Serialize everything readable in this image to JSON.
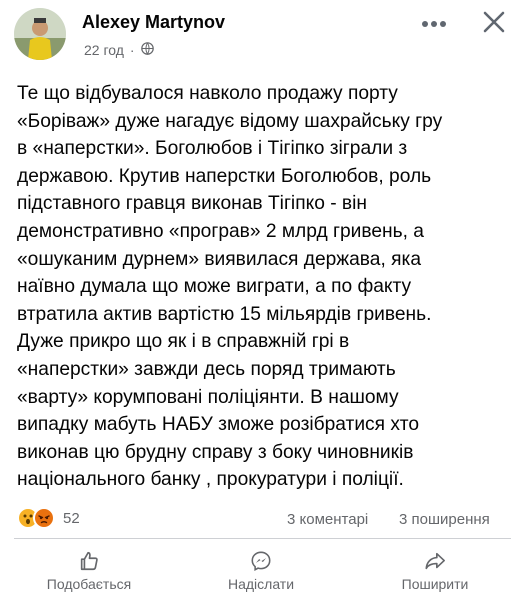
{
  "post": {
    "author": "Alexey Martynov",
    "time": "22 год",
    "text_lines": [
      "Те що відбувалося навколо продажу порту",
      "«Боріваж» дуже нагадує відому шахрайську гру",
      "в «наперстки». Боголюбов і Тігіпко зіграли з",
      "державою. Крутив наперстки Боголюбов, роль",
      "підставного гравця виконав Тігіпко - він",
      "демонстративно «програв» 2 млрд гривень, а",
      "«ошуканим дурнем» виявилася держава, яка",
      "наївно думала що може виграти, а по факту",
      "втратила актив вартістю 15 мільярдів гривень.",
      "Дуже прикро що як і в справжній грі в",
      "«наперстки» завжди десь поряд тримають",
      "«варту» корумповані поліціянти. В нашому",
      "випадку мабуть НАБУ зможе розібратися хто",
      "виконав цю брудну справу з боку чиновників",
      "національного банку , прокуратури і поліції."
    ]
  },
  "stats": {
    "reaction_count": "52",
    "comments": "3 коментарі",
    "shares": "3 поширення"
  },
  "actions": {
    "like": "Подобається",
    "send": "Надіслати",
    "share": "Поширити"
  },
  "icons": {
    "more": "more-horizontal-icon",
    "close": "close-icon",
    "globe": "globe-icon",
    "wow": "wow-reaction-icon",
    "angry": "angry-reaction-icon"
  },
  "colors": {
    "text": "#050505",
    "secondary": "#65676b",
    "wow": "#f7b125",
    "angry": "#e9710f",
    "divider": "#ced0d4"
  }
}
